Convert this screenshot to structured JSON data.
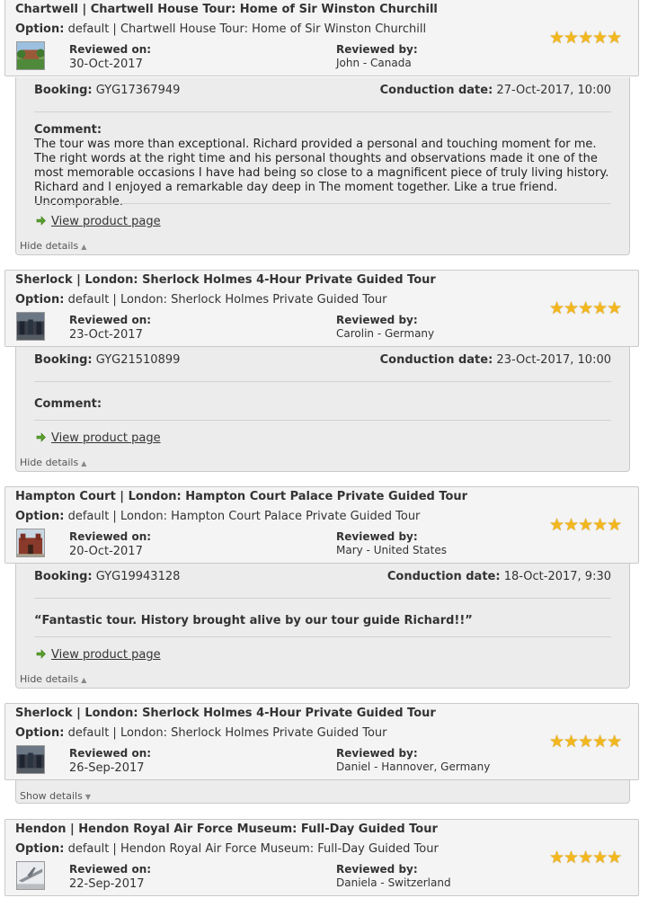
{
  "labels": {
    "option": "Option:",
    "reviewed_on": "Reviewed on:",
    "reviewed_by": "Reviewed by:",
    "booking": "Booking:",
    "conduction": "Conduction date:",
    "comment": "Comment:",
    "view_product": "View product page",
    "hide_details": "Hide details",
    "show_details": "Show details",
    "stars": "★★★★★"
  },
  "colors": {
    "star": "#f3b71e",
    "link_arrow": "#5aa02c"
  },
  "reviews": [
    {
      "title": "Chartwell | Chartwell House Tour: Home of Sir Winston Churchill",
      "option": "default | Chartwell House Tour: Home of Sir Winston Churchill",
      "reviewed_on": "30-Oct-2017",
      "reviewed_by": "John - Canada",
      "rating": 5,
      "thumb_icon": "garden-house-thumbnail",
      "booking": "GYG17367949",
      "conduction_date": "27-Oct-2017, 10:00",
      "comment": "The tour was more than exceptional. Richard provided a personal and touching moment for me. The right words at the right time and his personal thoughts and observations made it one of the most memorable occasions I have had being so close to a magnificent piece of truly living history. Richard and I enjoyed a remarkable day deep in The moment together. Like a true friend. Uncomporable."
    },
    {
      "title": "Sherlock | London: Sherlock Holmes 4-Hour Private Guided Tour",
      "option": "default | London: Sherlock Holmes Private Guided Tour",
      "reviewed_on": "23-Oct-2017",
      "reviewed_by": "Carolin - Germany",
      "rating": 5,
      "thumb_icon": "sherlock-street-thumbnail",
      "booking": "GYG21510899",
      "conduction_date": "23-Oct-2017, 10:00",
      "comment": ""
    },
    {
      "title": "Hampton Court | London: Hampton Court Palace Private Guided Tour",
      "option": "default | London: Hampton Court Palace Private Guided Tour",
      "reviewed_on": "20-Oct-2017",
      "reviewed_by": "Mary - United States",
      "rating": 5,
      "thumb_icon": "palace-thumbnail",
      "booking": "GYG19943128",
      "conduction_date": "18-Oct-2017, 9:30",
      "quote": "“Fantastic tour. History brought alive by our tour guide Richard!!”"
    },
    {
      "title": "Sherlock | London: Sherlock Holmes 4-Hour Private Guided Tour",
      "option": "default | London: Sherlock Holmes Private Guided Tour",
      "reviewed_on": "26-Sep-2017",
      "reviewed_by": "Daniel - Hannover, Germany",
      "rating": 5,
      "thumb_icon": "sherlock-street-thumbnail"
    },
    {
      "title": "Hendon | Hendon Royal Air Force Museum: Full-Day Guided Tour",
      "option": "default | Hendon Royal Air Force Museum: Full-Day Guided Tour",
      "reviewed_on": "22-Sep-2017",
      "reviewed_by": "Daniela - Switzerland",
      "rating": 5,
      "thumb_icon": "aircraft-museum-thumbnail"
    }
  ]
}
